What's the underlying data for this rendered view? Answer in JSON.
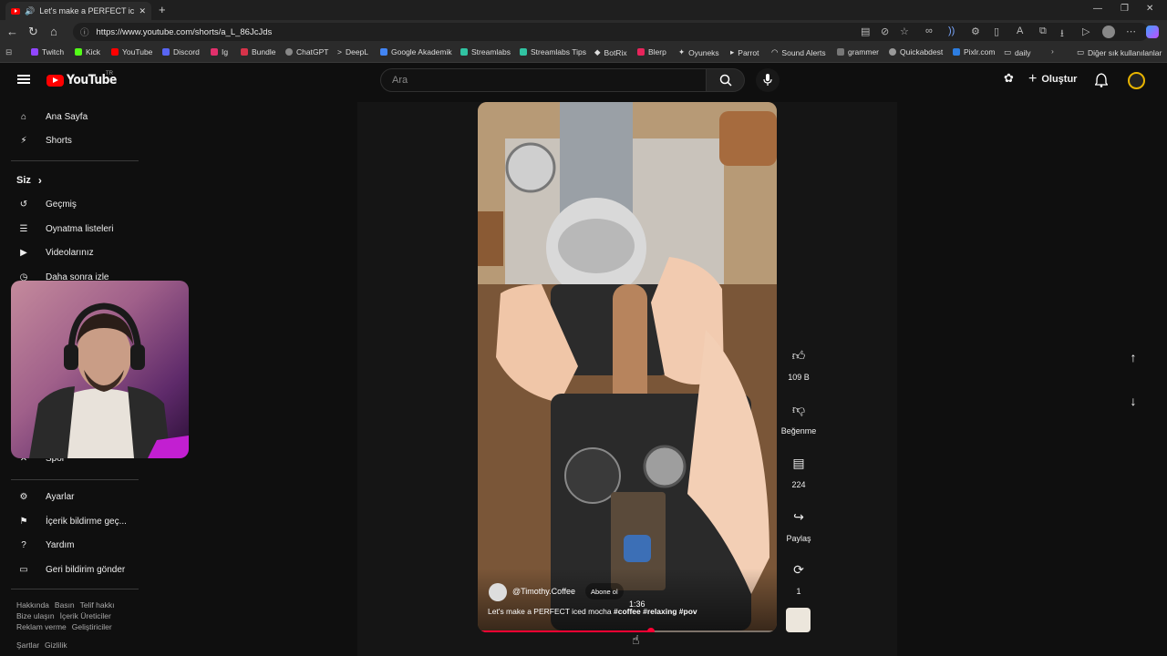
{
  "browser": {
    "tab_title": "Let's make a PERFECT iced m",
    "url": "https://www.youtube.com/shorts/a_L_86JcJds",
    "bookmarks": [
      "Twitch",
      "Kick",
      "YouTube",
      "Discord",
      "Ig",
      "Bundle",
      "ChatGPT",
      "DeepL",
      "Google Akademik",
      "Streamlabs",
      "Streamlabs Tips",
      "BotRix",
      "Blerp",
      "Oyuneks",
      "Parrot",
      "Sound Alerts",
      "grammer",
      "Quickabdest",
      "Pixlr.com",
      "daily"
    ],
    "other_bookmarks": "Diğer sık kullanılanlar"
  },
  "header": {
    "logo_text": "YouTube",
    "region": "TR",
    "search_placeholder": "Ara",
    "create_label": "Oluştur"
  },
  "sidebar": {
    "items": [
      {
        "label": "Ana Sayfa",
        "icon": "home-icon"
      },
      {
        "label": "Shorts",
        "icon": "shorts-icon"
      }
    ],
    "you_label": "Siz",
    "you_items": [
      {
        "label": "Geçmiş",
        "icon": "history-icon"
      },
      {
        "label": "Oynatma listeleri",
        "icon": "playlist-icon"
      },
      {
        "label": "Videolarınız",
        "icon": "video-icon"
      },
      {
        "label": "Daha sonra izle",
        "icon": "clock-icon"
      }
    ],
    "partial_item": "Spor",
    "bottom_items": [
      {
        "label": "Ayarlar",
        "icon": "gear-icon"
      },
      {
        "label": "İçerik bildirme geç...",
        "icon": "flag-icon"
      },
      {
        "label": "Yardım",
        "icon": "help-icon"
      },
      {
        "label": "Geri bildirim gönder",
        "icon": "feedback-icon"
      }
    ],
    "footer_row1": [
      "Hakkında",
      "Basın",
      "Telif hakkı"
    ],
    "footer_row2": [
      "Bize ulaşın",
      "İçerik Üreticiler"
    ],
    "footer_row3": [
      "Reklam verme",
      "Geliştiriciler"
    ],
    "footer_row4": [
      "Şartlar",
      "Gizlilik"
    ]
  },
  "video": {
    "channel": "@Timothy.Coffee",
    "subscribe_label": "Abone ol",
    "title_plain": "Let's make a PERFECT iced mocha ",
    "title_tags": "#coffee #relaxing #pov",
    "time": "1:36",
    "progress": 0.58
  },
  "actions": {
    "likes": "109 B",
    "dislike_label": "Beğenme",
    "comments": "224",
    "share_label": "Paylaş",
    "remix_count": "1"
  },
  "colors": {
    "accent": "#ff0033",
    "background": "#0f0f0f",
    "avatar_ring": "#e8b400"
  }
}
